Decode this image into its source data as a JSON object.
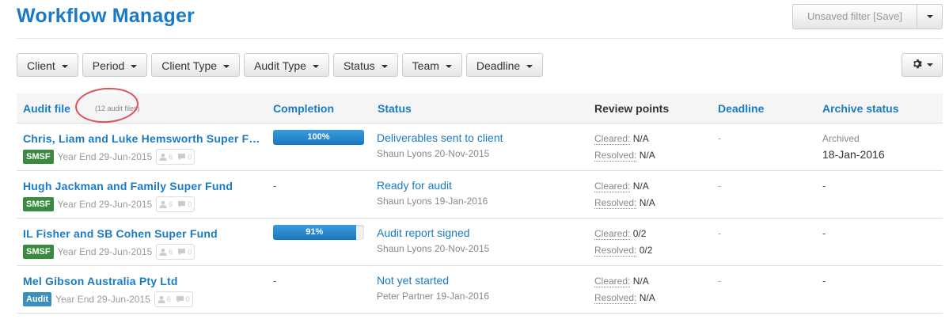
{
  "header": {
    "title": "Workflow Manager",
    "save_filter_label": "Unsaved filter [Save]"
  },
  "filters": [
    "Client",
    "Period",
    "Client Type",
    "Audit Type",
    "Status",
    "Team",
    "Deadline"
  ],
  "table": {
    "columns": {
      "audit_file": "Audit file",
      "audit_file_count": "(12 audit files)",
      "completion": "Completion",
      "status": "Status",
      "review_points": "Review points",
      "deadline": "Deadline",
      "archive_status": "Archive status"
    },
    "review_labels": {
      "cleared": "Cleared:",
      "resolved": "Resolved:"
    },
    "rows": [
      {
        "name": "Chris, Liam and Luke Hemsworth Super Fund",
        "type": "SMSF",
        "year_end": "Year End 29-Jun-2015",
        "people_count": "6",
        "comment_count": "0",
        "completion": "100%",
        "completion_fraction": 1.0,
        "status": "Deliverables sent to client",
        "status_by": "Shaun Lyons 20-Nov-2015",
        "cleared": "N/A",
        "resolved": "N/A",
        "deadline": "-",
        "archive_label": "Archived",
        "archive_date": "18-Jan-2016"
      },
      {
        "name": "Hugh Jackman and Family Super Fund",
        "type": "SMSF",
        "year_end": "Year End 29-Jun-2015",
        "people_count": "6",
        "comment_count": "0",
        "completion": "-",
        "status": "Ready for audit",
        "status_by": "Shaun Lyons 19-Jan-2016",
        "cleared": "N/A",
        "resolved": "N/A",
        "deadline": "-",
        "archive_label": "-",
        "archive_date": ""
      },
      {
        "name": "IL Fisher and SB Cohen Super Fund",
        "type": "SMSF",
        "year_end": "Year End 29-Jun-2015",
        "people_count": "6",
        "comment_count": "0",
        "completion": "91%",
        "completion_fraction": 0.91,
        "status": "Audit report signed",
        "status_by": "Shaun Lyons 20-Nov-2015",
        "cleared": "0/2",
        "resolved": "0/2",
        "deadline": "-",
        "archive_label": "-",
        "archive_date": ""
      },
      {
        "name": "Mel Gibson Australia Pty Ltd",
        "type": "Audit",
        "year_end": "Year End 29-Jun-2015",
        "people_count": "6",
        "comment_count": "0",
        "completion": "-",
        "status": "Not yet started",
        "status_by": "Peter Partner 19-Jan-2016",
        "cleared": "N/A",
        "resolved": "N/A",
        "deadline": "-",
        "archive_label": "-",
        "archive_date": ""
      }
    ]
  },
  "colors": {
    "accent": "#1a7bc4",
    "smsf_badge": "#3a8a3f",
    "audit_badge": "#3a8fbf",
    "annotation": "#e0505a"
  }
}
